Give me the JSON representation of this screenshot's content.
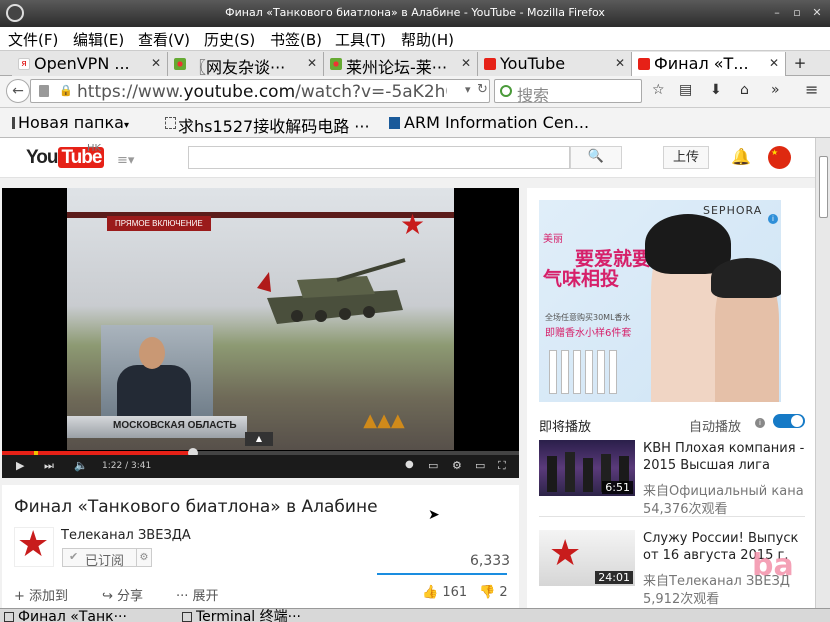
{
  "window": {
    "title": "Финал «Танкового биатлона» в Алабине - YouTube - Mozilla Firefox"
  },
  "menu": [
    "文件(F)",
    "编辑(E)",
    "查看(V)",
    "历史(S)",
    "书签(B)",
    "工具(T)",
    "帮助(H)"
  ],
  "tabs": [
    {
      "label": "OpenVPN ...",
      "favicon_color": "#e8e8e8"
    },
    {
      "label": "〖网友杂谈···",
      "favicon_color": "#6a3"
    },
    {
      "label": "莱州论坛-莱···",
      "favicon_color": "#6a3"
    },
    {
      "label": "YouTube",
      "favicon_color": "#e62117"
    },
    {
      "label": "Финал «Т...",
      "favicon_color": "#e62117"
    }
  ],
  "nav": {
    "url_prefix": "https://www.",
    "url_domain": "youtube.com",
    "url_rest": "/watch?v=-5aK2h0(",
    "search_placeholder": "搜索"
  },
  "bookmarks": [
    {
      "label": "Новая папка"
    },
    {
      "label": "求hs1527接收解码电路 ···"
    },
    {
      "label": "ARM Information Cen..."
    }
  ],
  "youtube": {
    "logo_you": "You",
    "logo_tube": "Tube",
    "region": "HK",
    "search_button": "🔍",
    "upload": "上传"
  },
  "player": {
    "live_label": "ПРЯМОЕ ВКЛЮЧЕНИЕ",
    "lower_third": "МОСКОВСКАЯ ОБЛАСТЬ",
    "time": "1:22 / 3:41",
    "played_fraction": 0.37
  },
  "video": {
    "title": "Финал «Танкового биатлона» в Алабине",
    "channel": "Телеканал ЗВЕЗДА",
    "subscribed_label": "已订阅",
    "views": "6,333",
    "actions": {
      "add": "添加到",
      "share": "分享",
      "more": "展开"
    },
    "likes": "161",
    "dislikes": "2"
  },
  "ad": {
    "brand": "SEPHORA",
    "tag": "美丽",
    "slogan1": "要爱就要",
    "slogan2": "气味相投",
    "sub1": "全场任意购买30ML香水",
    "sub2": "即赠香水小样6件套"
  },
  "sidebar": {
    "up_next": "即将播放",
    "autoplay": "自动播放",
    "items": [
      {
        "title": "КВН Плохая компания - 2015 Высшая лига",
        "channel": "来自Официальный кана",
        "views": "54,376次观看",
        "duration": "6:51"
      },
      {
        "title": "Служу России! Выпуск от 16 августа 2015 г.",
        "channel": "来自Телеканал ЗВЕЗД",
        "views": "5,912次观看",
        "duration": "24:01"
      }
    ]
  },
  "watermark": "ba",
  "taskbar": [
    "Финал «Танк···",
    "Terminal 终端···"
  ]
}
